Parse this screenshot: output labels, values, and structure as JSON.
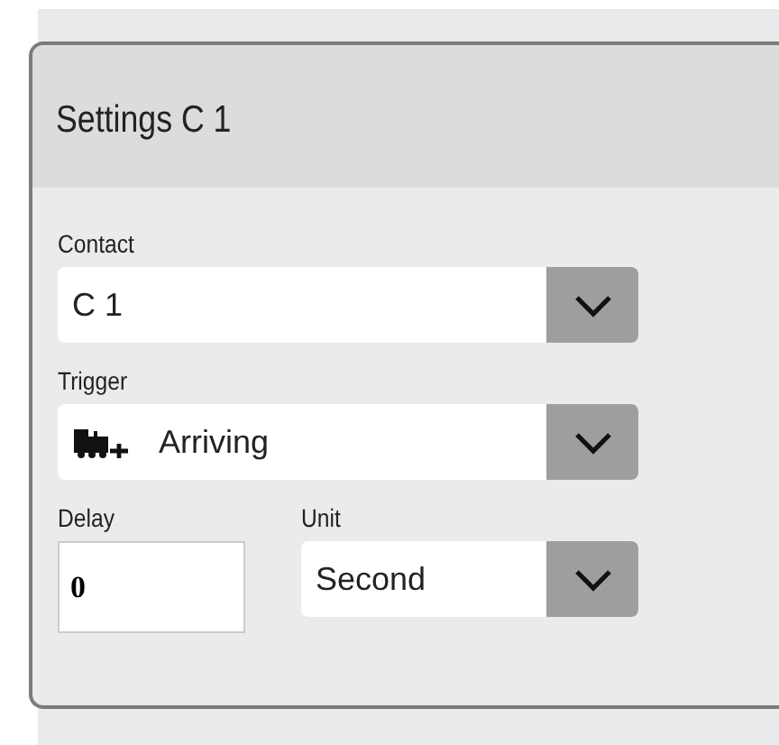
{
  "panel": {
    "title": "Settings C 1"
  },
  "rows": [
    {
      "fields": [
        {
          "kind": "select",
          "label": "Contact",
          "value": "C 1"
        }
      ]
    },
    {
      "fields": [
        {
          "kind": "iconselect",
          "label": "Trigger",
          "value": "Arriving"
        }
      ]
    },
    {
      "fields": [
        {
          "kind": "input",
          "label": "Delay",
          "value": "0"
        },
        {
          "kind": "select",
          "label": "Unit",
          "value": "Second"
        }
      ]
    }
  ]
}
